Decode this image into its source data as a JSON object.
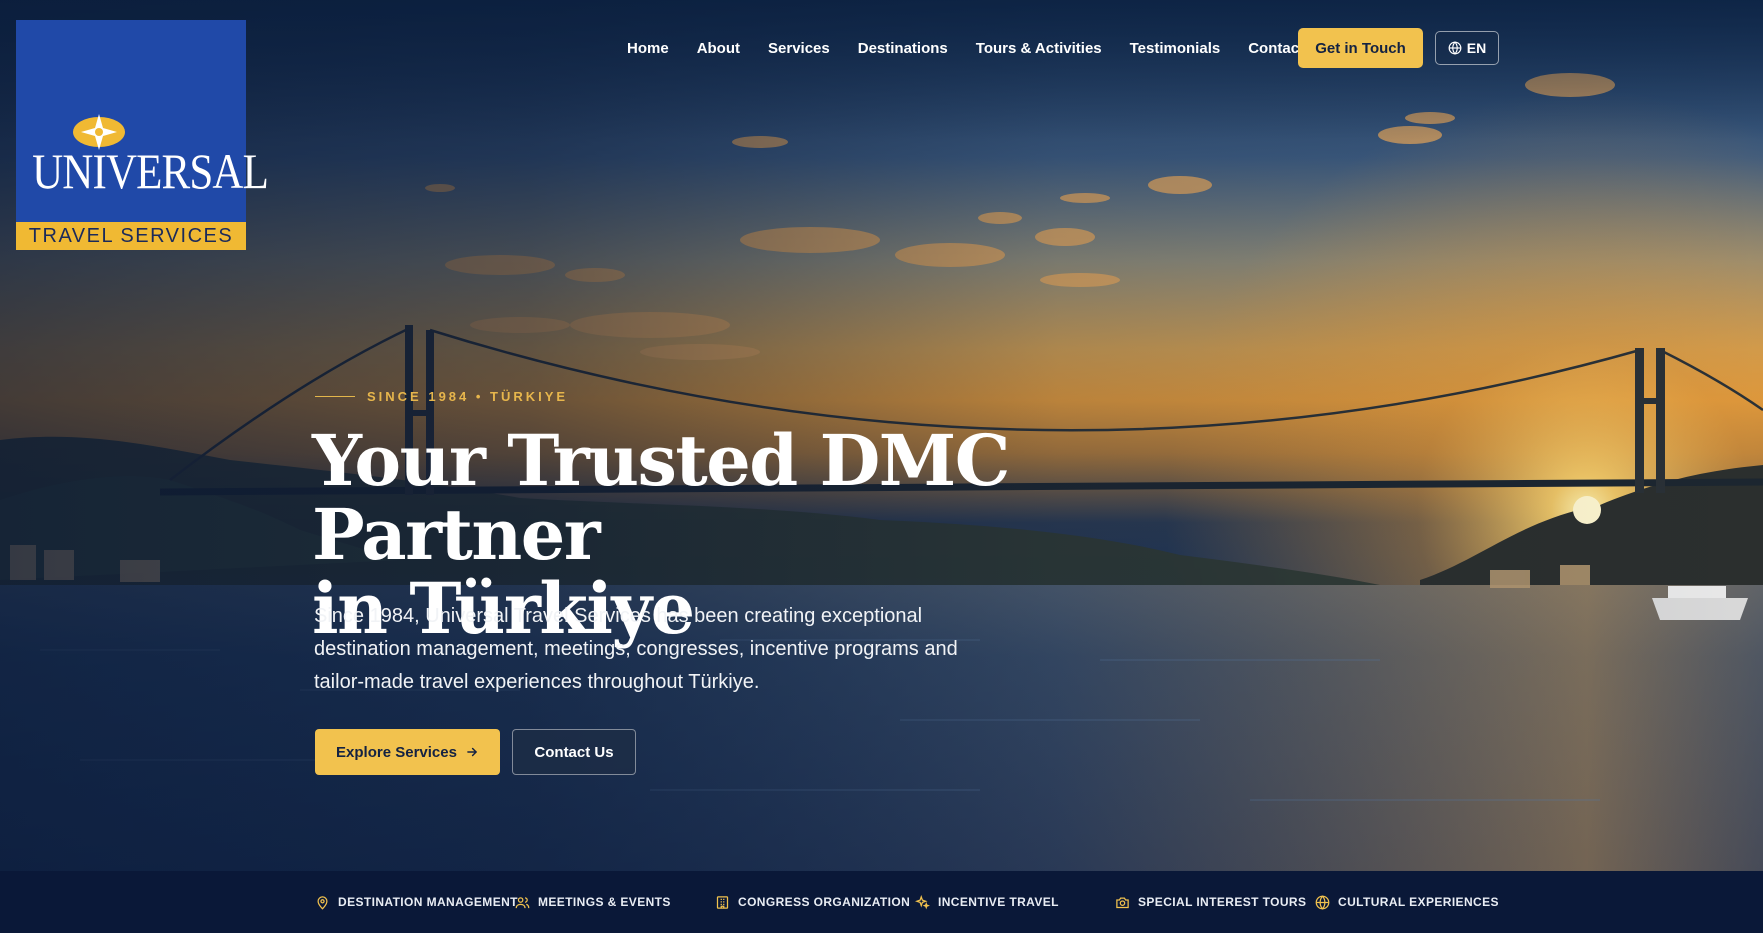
{
  "logo": {
    "wordmark": "UNIVERSAL",
    "tagline": "TRAVEL SERVICES"
  },
  "nav": {
    "items": [
      {
        "label": "Home"
      },
      {
        "label": "About"
      },
      {
        "label": "Services"
      },
      {
        "label": "Destinations"
      },
      {
        "label": "Tours & Activities"
      },
      {
        "label": "Testimonials"
      },
      {
        "label": "Contact"
      }
    ],
    "cta_label": "Get in Touch",
    "language": "EN"
  },
  "hero": {
    "eyebrow": "SINCE 1984 • TÜRKIYE",
    "headline_line1": "Your Trusted DMC Partner",
    "headline_line2": "in Türkiye",
    "subcopy": "Since 1984, Universal Travel Services has been creating exceptional destination management, meetings, congresses, incentive programs and tailor-made travel experiences throughout Türkiye.",
    "primary_button": "Explore Services",
    "secondary_button": "Contact Us"
  },
  "services_strip": [
    {
      "label": "DESTINATION MANAGEMENT",
      "icon": "map-pin-icon"
    },
    {
      "label": "MEETINGS & EVENTS",
      "icon": "users-icon"
    },
    {
      "label": "CONGRESS ORGANIZATION",
      "icon": "building-icon"
    },
    {
      "label": "INCENTIVE TRAVEL",
      "icon": "sparkles-icon"
    },
    {
      "label": "SPECIAL INTEREST TOURS",
      "icon": "camera-icon"
    },
    {
      "label": "CULTURAL EXPERIENCES",
      "icon": "globe-icon"
    }
  ],
  "colors": {
    "accent_gold": "#f2c24e",
    "brand_blue": "#2049a8",
    "navy": "#0a1838"
  }
}
